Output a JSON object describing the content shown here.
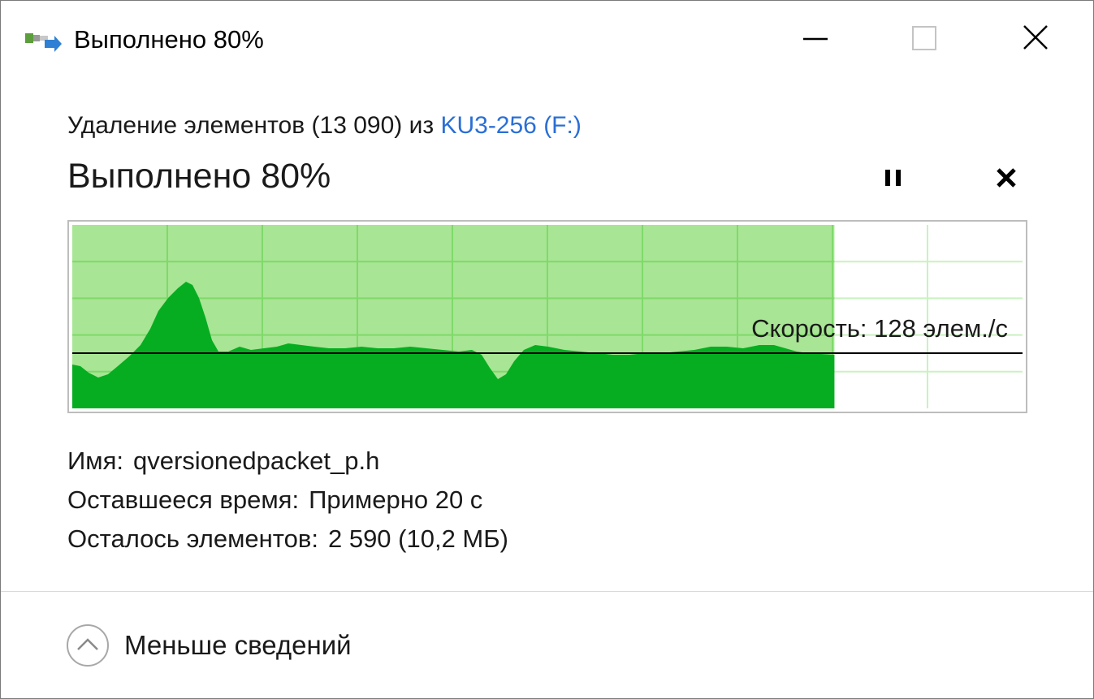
{
  "window": {
    "title": "Выполнено 80%",
    "icon": "file-transfer-icon",
    "controls": {
      "minimize": "minimize-icon",
      "maximize": "maximize-icon",
      "close": "close-icon"
    }
  },
  "operation": {
    "prefix": "Удаление элементов (13 090) из",
    "source_link": "KU3-256 (F:)"
  },
  "progress": {
    "title": "Выполнено 80%",
    "percent": 80,
    "pause_icon": "pause-icon",
    "cancel_icon": "cancel-icon"
  },
  "graph": {
    "speed_label": "Скорость: 128 элем./с",
    "colors": {
      "done_background": "#a8e594",
      "speed_fill": "#06ad21",
      "grid_light": "#c9f2bf",
      "grid_on_fill": "#7fd96a",
      "speed_line": "#000000",
      "border": "#bdbdbd"
    }
  },
  "details": {
    "name_label": "Имя:",
    "name_value": "qversionedpacket_p.h",
    "time_label": "Оставшееся время:",
    "time_value": "Примерно 20 с",
    "items_label": "Осталось элементов:",
    "items_value": "2 590 (10,2 МБ)"
  },
  "footer": {
    "less_details_label": "Меньше сведений",
    "less_details_icon": "chevron-up-circle-icon"
  }
}
